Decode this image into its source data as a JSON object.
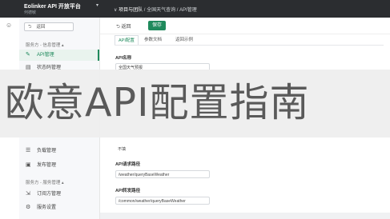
{
  "topbar": {
    "brand": "Eolinker API 开放平台",
    "brand_sub": "何德敏",
    "caret": "▾",
    "breadcrumb": [
      "项目与团队",
      "全国天气查询",
      "API管理"
    ],
    "breadcrumb_sep": "/"
  },
  "sidebar": {
    "back_label": "返回",
    "group_api": "服务方 - 信息管理 ▴",
    "items_top": [
      {
        "label": "API管理",
        "active": true,
        "icon": "gear-icon"
      },
      {
        "label": "状态码管理",
        "active": false,
        "icon": "list-icon"
      }
    ],
    "items_mid": [
      {
        "label": "负载管理",
        "icon": "stack-icon"
      },
      {
        "label": "发布管理",
        "icon": "publish-icon"
      }
    ],
    "group_service": "服务方 - 服务管理 ▴",
    "items_bottom": [
      {
        "label": "订阅方管理",
        "icon": "users-icon"
      },
      {
        "label": "服务设置",
        "icon": "settings-icon"
      }
    ]
  },
  "toolbar": {
    "back_label": "返回",
    "save_label": "保存"
  },
  "tabs": [
    "API配置",
    "参数文档",
    "返回示例"
  ],
  "form": {
    "api_name_label": "API名称",
    "api_name_value": "全国天气预报",
    "request_path_label": "API请求路径",
    "request_path_value": "/weather/queryBaseWeather",
    "forward_path_label": "API转发路径",
    "forward_path_value": "/common/weather/queryBaseWeather",
    "partial_label": "不填"
  },
  "overlay": {
    "title": "欧意API配置指南"
  },
  "colors": {
    "accent": "#1f8a5c",
    "topbar": "#2b2d30"
  }
}
